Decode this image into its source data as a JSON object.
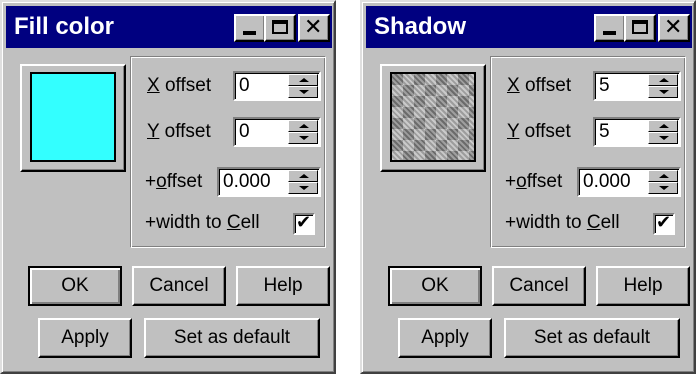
{
  "dialogs": [
    {
      "title": "Fill color",
      "swatch": {
        "kind": "solid",
        "color": "#33ffff"
      },
      "x_offset": {
        "label_key": "X",
        "label_rest": " offset",
        "value": "0"
      },
      "y_offset": {
        "label_key": "Y",
        "label_rest": " offset",
        "value": "0"
      },
      "plus_offset": {
        "label_pre": "+",
        "label_key": "o",
        "label_rest": "ffset",
        "value": "0.000"
      },
      "width_to_cell": {
        "label_pre": "+width to ",
        "label_key": "C",
        "label_rest": "ell",
        "checked": true,
        "mark": "✔"
      },
      "buttons": {
        "ok": "OK",
        "cancel": "Cancel",
        "help": "Help",
        "apply": "Apply",
        "set_default": "Set as default"
      },
      "window_buttons": {
        "close_glyph": "✕"
      }
    },
    {
      "title": "Shadow",
      "swatch": {
        "kind": "pattern",
        "color": "#9c9c9c"
      },
      "x_offset": {
        "label_key": "X",
        "label_rest": " offset",
        "value": "5"
      },
      "y_offset": {
        "label_key": "Y",
        "label_rest": " offset",
        "value": "5"
      },
      "plus_offset": {
        "label_pre": "+",
        "label_key": "o",
        "label_rest": "ffset",
        "value": "0.000"
      },
      "width_to_cell": {
        "label_pre": "+width to ",
        "label_key": "C",
        "label_rest": "ell",
        "checked": true,
        "mark": "✔"
      },
      "buttons": {
        "ok": "OK",
        "cancel": "Cancel",
        "help": "Help",
        "apply": "Apply",
        "set_default": "Set as default"
      },
      "window_buttons": {
        "close_glyph": "✕"
      }
    }
  ],
  "colors": {
    "title_bar": "#000080",
    "face": "#c0c0c0"
  }
}
